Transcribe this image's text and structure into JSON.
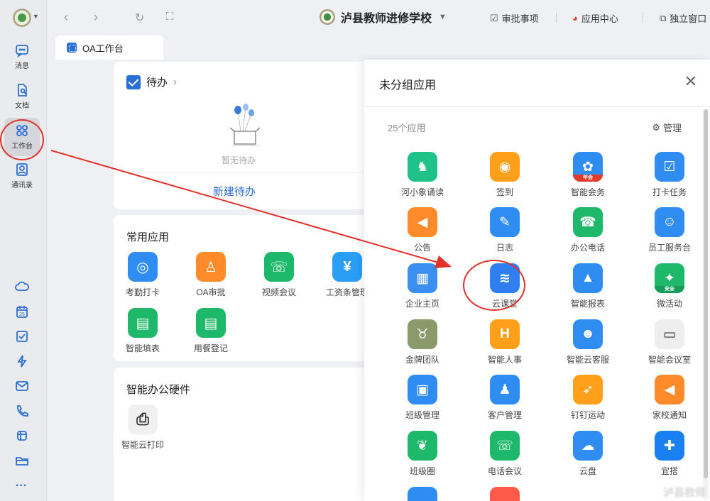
{
  "rail": {
    "items": [
      {
        "label": "消息",
        "icon": "chat-icon"
      },
      {
        "label": "文档",
        "icon": "document-icon"
      },
      {
        "label": "工作台",
        "icon": "grid-icon"
      },
      {
        "label": "通讯录",
        "icon": "contacts-icon"
      }
    ],
    "bottom_icons": [
      "cloud-icon",
      "calendar-icon",
      "check-icon",
      "bolt-icon",
      "mail-icon",
      "phone-icon",
      "box-icon",
      "folder-icon",
      "more-icon"
    ],
    "calendar_day": "25",
    "more": "···"
  },
  "topbar": {
    "back": "‹",
    "forward": "›",
    "org_name": "泸县教师进修学校",
    "approval": "审批事项",
    "app_center": "应用中心",
    "standalone": "独立窗口"
  },
  "tab": {
    "label": "OA工作台"
  },
  "todo": {
    "title": "待办",
    "empty": "暂无待办",
    "new": "新建待办"
  },
  "common_apps": {
    "title": "常用应用",
    "apps": [
      {
        "label": "考勤打卡",
        "color": "#2f8cf0",
        "glyph": "◎"
      },
      {
        "label": "OA审批",
        "color": "#ff8a2a",
        "glyph": "♙"
      },
      {
        "label": "视频会议",
        "color": "#1eb86a",
        "glyph": "☏"
      },
      {
        "label": "工资条管理",
        "color": "#2a9df4",
        "glyph": "¥"
      },
      {
        "label": "智能填表",
        "color": "#1eb86a",
        "glyph": "▤"
      },
      {
        "label": "用餐登记",
        "color": "#1eb86a",
        "glyph": "▤"
      }
    ]
  },
  "hardware": {
    "title": "智能办公硬件",
    "apps": [
      {
        "label": "智能云打印",
        "color": "#f0f0f0",
        "glyph": "⎙"
      }
    ]
  },
  "panel": {
    "title": "未分组应用",
    "count": "25个应用",
    "manage": "管理",
    "apps": [
      {
        "label": "河小象诵读",
        "color": "#1fc38a",
        "glyph": "♞"
      },
      {
        "label": "签到",
        "color": "#ff9f1a",
        "glyph": "◉"
      },
      {
        "label": "智能会务",
        "color": "#2f8cf0",
        "glyph": "✿",
        "badge": "年会"
      },
      {
        "label": "打卡任务",
        "color": "#2f8cf0",
        "glyph": "☑"
      },
      {
        "label": "公告",
        "color": "#ff8a2a",
        "glyph": "◀"
      },
      {
        "label": "日志",
        "color": "#2f8cf0",
        "glyph": "✎"
      },
      {
        "label": "办公电话",
        "color": "#1eb86a",
        "glyph": "☎"
      },
      {
        "label": "员工服务台",
        "color": "#2f8cf0",
        "glyph": "☺"
      },
      {
        "label": "企业主页",
        "color": "#3a8ff0",
        "glyph": "▦"
      },
      {
        "label": "云课堂",
        "color": "#2f7ff0",
        "glyph": "≋"
      },
      {
        "label": "智能报表",
        "color": "#2f8cf0",
        "glyph": "▲"
      },
      {
        "label": "微活动",
        "color": "#1eb86a",
        "glyph": "✦",
        "badge": "安全"
      },
      {
        "label": "金牌团队",
        "color": "#8a9a6a",
        "glyph": "♉"
      },
      {
        "label": "智能人事",
        "color": "#ff9f1a",
        "glyph": "H"
      },
      {
        "label": "智能云客服",
        "color": "#2f8cf0",
        "glyph": "☻"
      },
      {
        "label": "智能会议室",
        "color": "#eeeeee",
        "glyph": "▭"
      },
      {
        "label": "班级管理",
        "color": "#2f8cf0",
        "glyph": "▣"
      },
      {
        "label": "客户管理",
        "color": "#2f8cf0",
        "glyph": "♟"
      },
      {
        "label": "钉钉运动",
        "color": "#ff9f1a",
        "glyph": "➶"
      },
      {
        "label": "家校通知",
        "color": "#ff8a2a",
        "glyph": "◀"
      },
      {
        "label": "班级圈",
        "color": "#1eb86a",
        "glyph": "❦"
      },
      {
        "label": "电话会议",
        "color": "#1eb86a",
        "glyph": "☏"
      },
      {
        "label": "云盘",
        "color": "#2f8cf0",
        "glyph": "☁"
      },
      {
        "label": "宜搭",
        "color": "#1a7ff0",
        "glyph": "✚"
      },
      {
        "label": "",
        "color": "#2f8cf0",
        "glyph": ""
      },
      {
        "label": "",
        "color": "#ff5a4a",
        "glyph": ""
      }
    ]
  },
  "watermark": "泸县教师"
}
